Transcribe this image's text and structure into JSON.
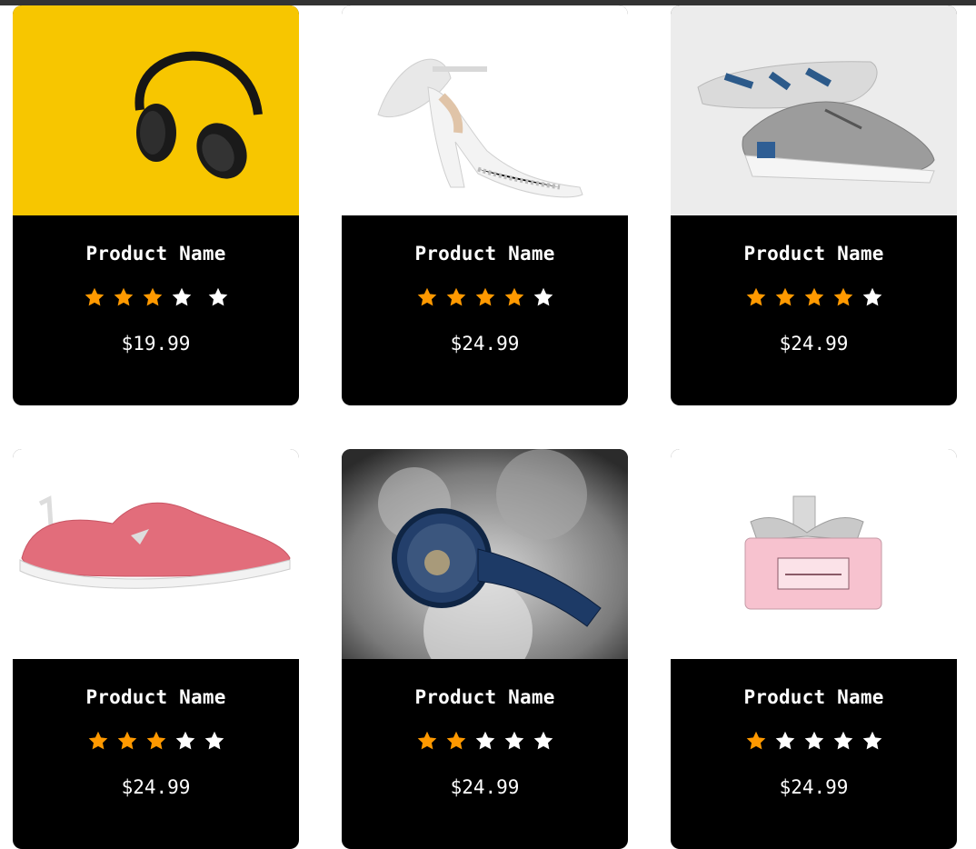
{
  "colors": {
    "card_bg": "#000000",
    "star_filled": "#ff9900",
    "star_empty": "#ffffff",
    "text": "#ffffff"
  },
  "products": [
    {
      "image": "headphones",
      "name": "Product Name",
      "rating": 3,
      "max_rating": 5,
      "price": "$19.99"
    },
    {
      "image": "white-heel-sandal",
      "name": "Product Name",
      "rating": 4,
      "max_rating": 5,
      "price": "$24.99"
    },
    {
      "image": "grey-sneaker",
      "name": "Product Name",
      "rating": 4,
      "max_rating": 5,
      "price": "$24.99"
    },
    {
      "image": "pink-slip-on-shoe",
      "name": "Product Name",
      "rating": 3,
      "max_rating": 5,
      "price": "$24.99"
    },
    {
      "image": "blue-wristwatch",
      "name": "Product Name",
      "rating": 2,
      "max_rating": 5,
      "price": "$24.99"
    },
    {
      "image": "perfume-bottle",
      "name": "Product Name",
      "rating": 1,
      "max_rating": 5,
      "price": "$24.99"
    }
  ]
}
